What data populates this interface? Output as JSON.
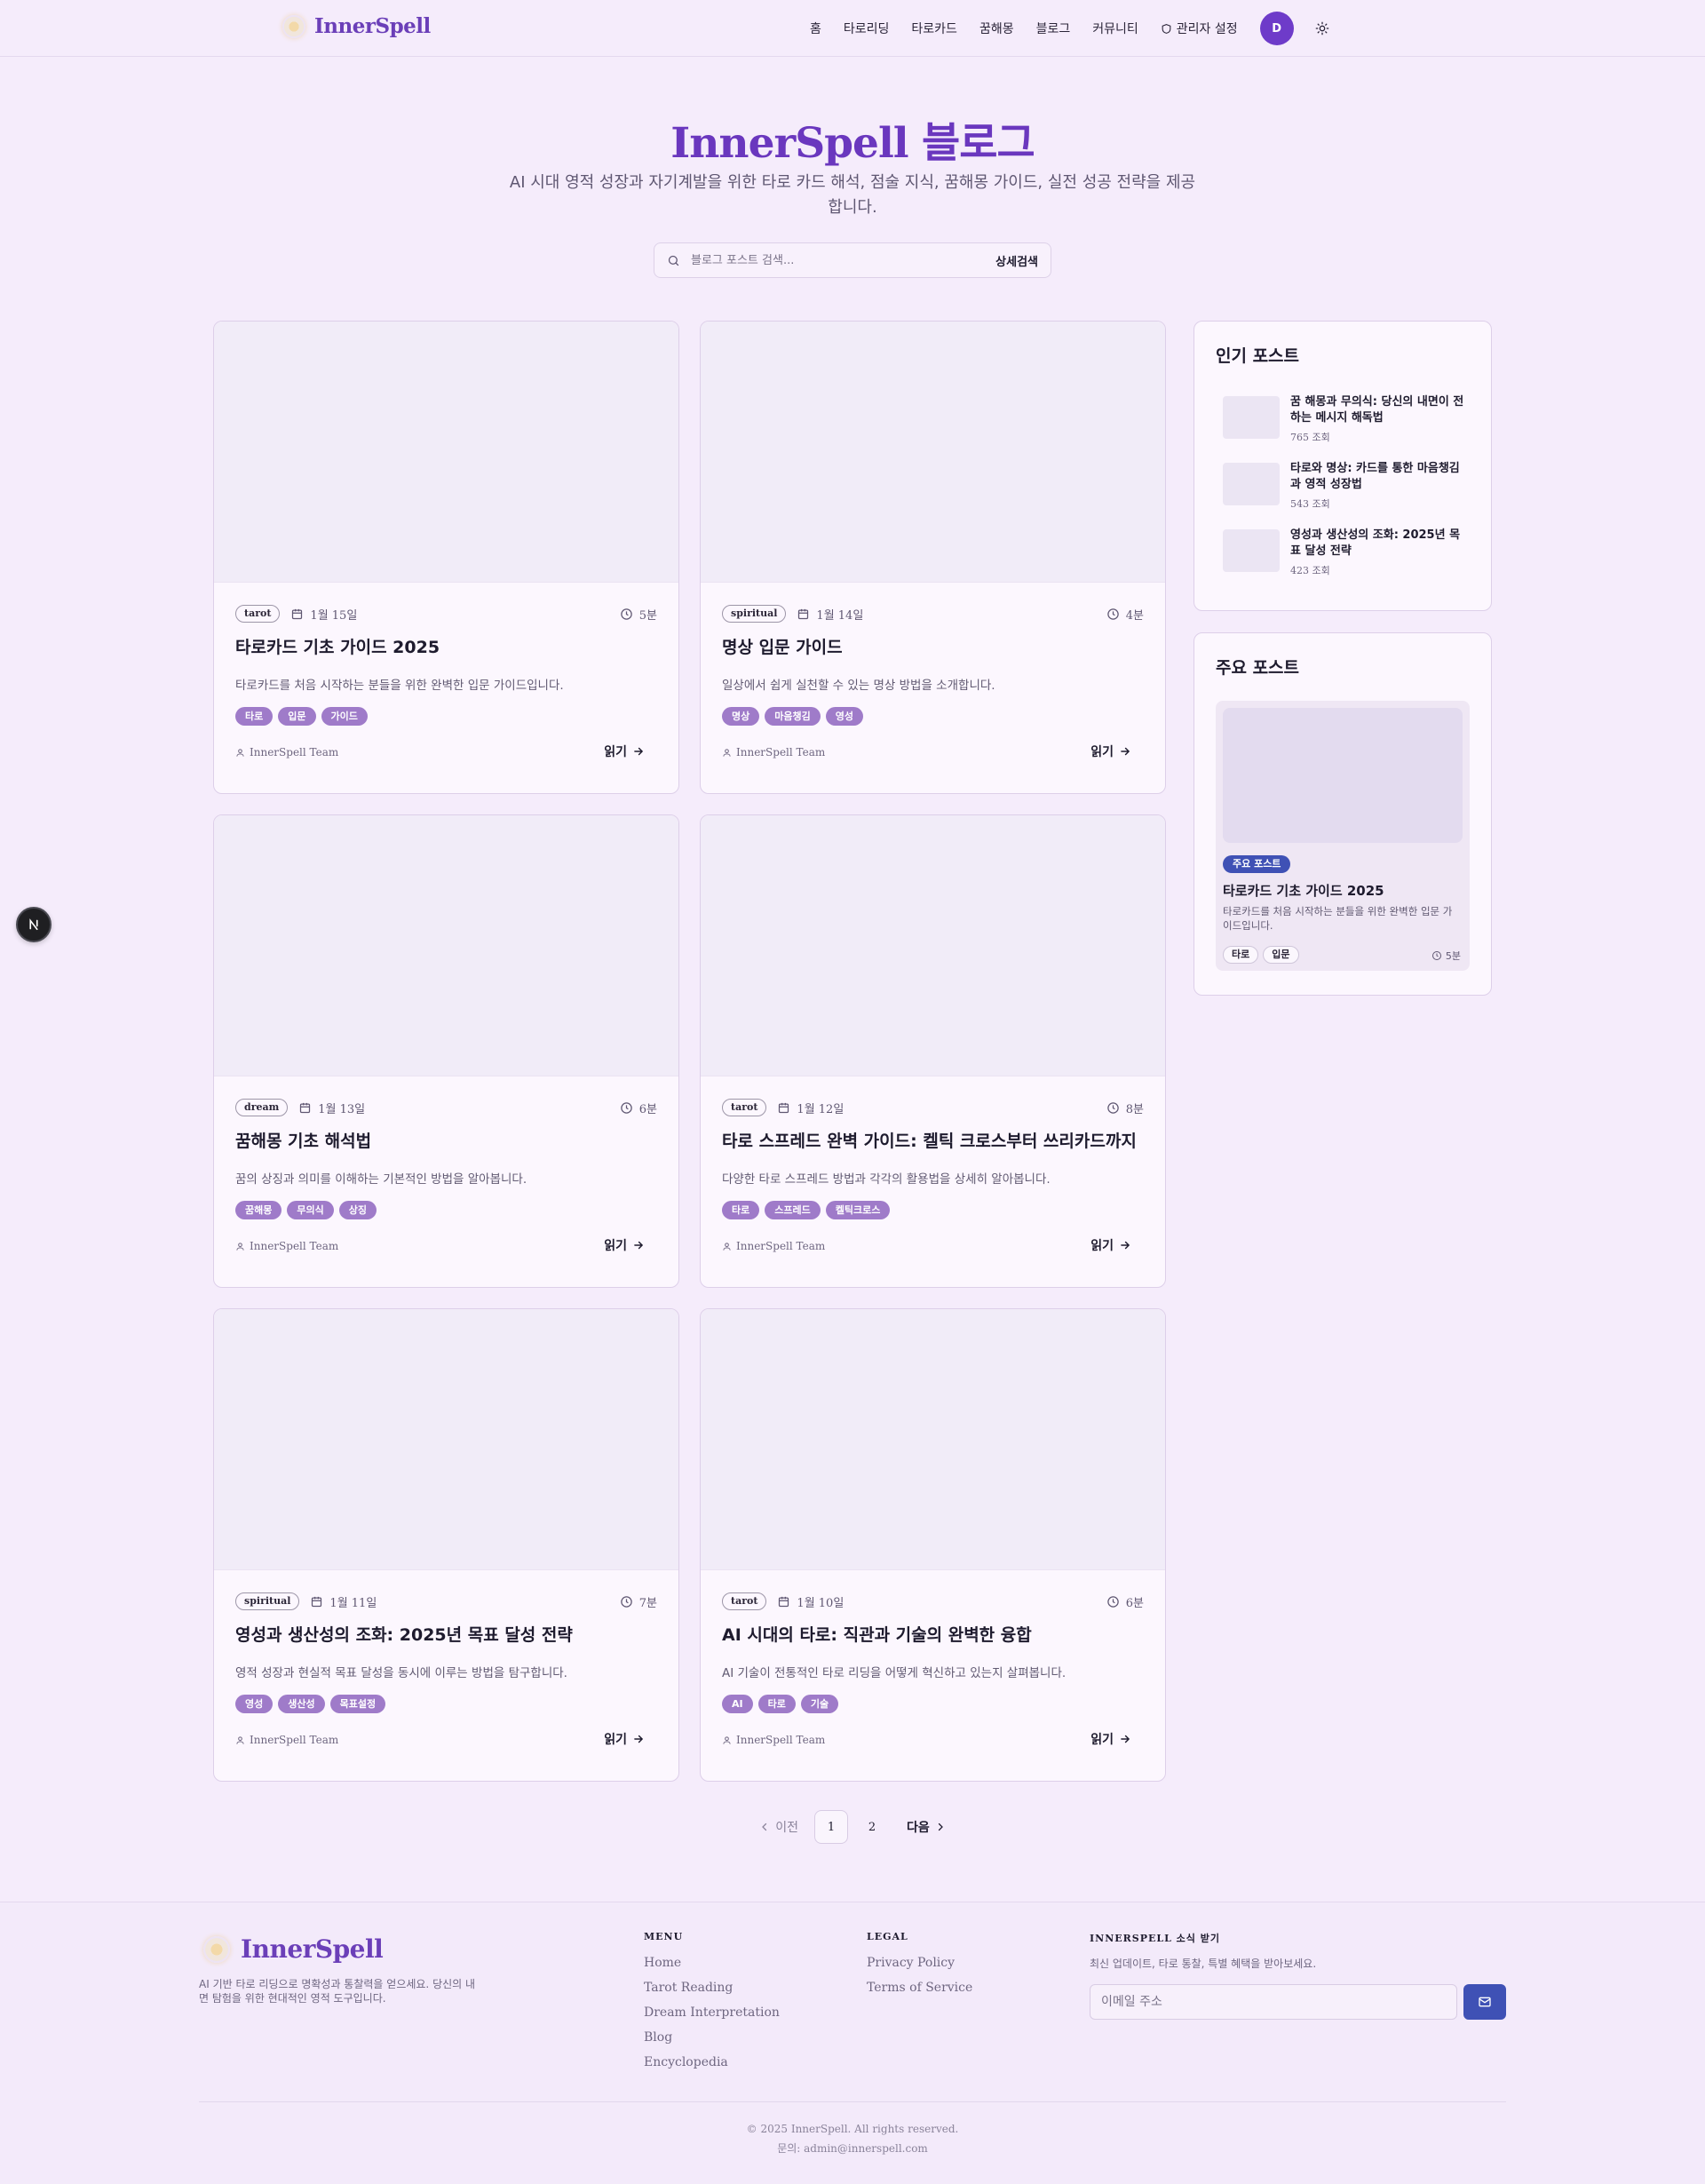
{
  "header": {
    "logo": "InnerSpell",
    "nav": [
      "홈",
      "타로리딩",
      "타로카드",
      "꿈해몽",
      "블로그",
      "커뮤니티"
    ],
    "admin_label": "관리자 설정",
    "avatar": "D"
  },
  "hero": {
    "title": "InnerSpell 블로그",
    "subtitle": "AI 시대 영적 성장과 자기계발을 위한 타로 카드 해석, 점술 지식, 꿈해몽 가이드, 실전 성공 전략을 제공합니다.",
    "search_placeholder": "블로그 포스트 검색...",
    "advanced_search": "상세검색"
  },
  "posts": [
    {
      "category": "tarot",
      "date": "1월 15일",
      "read_time": "5분",
      "title": "타로카드 기초 가이드 2025",
      "excerpt": "타로카드를 처음 시작하는 분들을 위한 완벽한 입문 가이드입니다.",
      "tags": [
        "타로",
        "입문",
        "가이드"
      ],
      "author": "InnerSpell Team",
      "read_label": "읽기"
    },
    {
      "category": "spiritual",
      "date": "1월 14일",
      "read_time": "4분",
      "title": "명상 입문 가이드",
      "excerpt": "일상에서 쉽게 실천할 수 있는 명상 방법을 소개합니다.",
      "tags": [
        "명상",
        "마음챙김",
        "영성"
      ],
      "author": "InnerSpell Team",
      "read_label": "읽기"
    },
    {
      "category": "dream",
      "date": "1월 13일",
      "read_time": "6분",
      "title": "꿈해몽 기초 해석법",
      "excerpt": "꿈의 상징과 의미를 이해하는 기본적인 방법을 알아봅니다.",
      "tags": [
        "꿈해몽",
        "무의식",
        "상징"
      ],
      "author": "InnerSpell Team",
      "read_label": "읽기"
    },
    {
      "category": "tarot",
      "date": "1월 12일",
      "read_time": "8분",
      "title": "타로 스프레드 완벽 가이드: 켈틱 크로스부터 쓰리카드까지",
      "excerpt": "다양한 타로 스프레드 방법과 각각의 활용법을 상세히 알아봅니다.",
      "tags": [
        "타로",
        "스프레드",
        "켈틱크로스"
      ],
      "author": "InnerSpell Team",
      "read_label": "읽기"
    },
    {
      "category": "spiritual",
      "date": "1월 11일",
      "read_time": "7분",
      "title": "영성과 생산성의 조화: 2025년 목표 달성 전략",
      "excerpt": "영적 성장과 현실적 목표 달성을 동시에 이루는 방법을 탐구합니다.",
      "tags": [
        "영성",
        "생산성",
        "목표설정"
      ],
      "author": "InnerSpell Team",
      "read_label": "읽기"
    },
    {
      "category": "tarot",
      "date": "1월 10일",
      "read_time": "6분",
      "title": "AI 시대의 타로: 직관과 기술의 완벽한 융합",
      "excerpt": "AI 기술이 전통적인 타로 리딩을 어떻게 혁신하고 있는지 살펴봅니다.",
      "tags": [
        "AI",
        "타로",
        "기술"
      ],
      "author": "InnerSpell Team",
      "read_label": "읽기"
    }
  ],
  "sidebar": {
    "popular_title": "인기 포스트",
    "popular": [
      {
        "title": "꿈 해몽과 무의식: 당신의 내면이 전하는 메시지 해독법",
        "views": "765 조회"
      },
      {
        "title": "타로와 명상: 카드를 통한 마음챙김과 영적 성장법",
        "views": "543 조회"
      },
      {
        "title": "영성과 생산성의 조화: 2025년 목표 달성 전략",
        "views": "423 조회"
      }
    ],
    "featured_title": "주요 포스트",
    "featured": {
      "badge": "주요 포스트",
      "title": "타로카드 기초 가이드 2025",
      "excerpt": "타로카드를 처음 시작하는 분들을 위한 완벽한 입문 가이드입니다.",
      "tags": [
        "타로",
        "입문"
      ],
      "read_time": "5분"
    }
  },
  "pagination": {
    "prev": "이전",
    "pages": [
      "1",
      "2"
    ],
    "next": "다음"
  },
  "footer": {
    "logo": "InnerSpell",
    "description": "AI 기반 타로 리딩으로 명확성과 통찰력을 얻으세요. 당신의 내면 탐험을 위한 현대적인 영적 도구입니다.",
    "menu_title": "MENU",
    "menu": [
      "Home",
      "Tarot Reading",
      "Dream Interpretation",
      "Blog",
      "Encyclopedia"
    ],
    "legal_title": "LEGAL",
    "legal": [
      "Privacy Policy",
      "Terms of Service"
    ],
    "newsletter_title": "INNERSPELL 소식 받기",
    "newsletter_desc": "최신 업데이트, 타로 통찰, 특별 혜택을 받아보세요.",
    "email_placeholder": "이메일 주소",
    "copyright": "© 2025 InnerSpell. All rights reserved.",
    "contact": "문의: admin@innerspell.com"
  },
  "colors": {
    "accent": "#6a37be",
    "tag": "#9f7bc9",
    "badge": "#3f51b5",
    "background": "#f5ecfb"
  },
  "icons": [
    "shield-icon",
    "sun-icon",
    "search-icon",
    "calendar-icon",
    "clock-icon",
    "user-icon",
    "arrow-right-icon",
    "chevron-left-icon",
    "chevron-right-icon",
    "mail-icon",
    "next-logo-icon"
  ]
}
